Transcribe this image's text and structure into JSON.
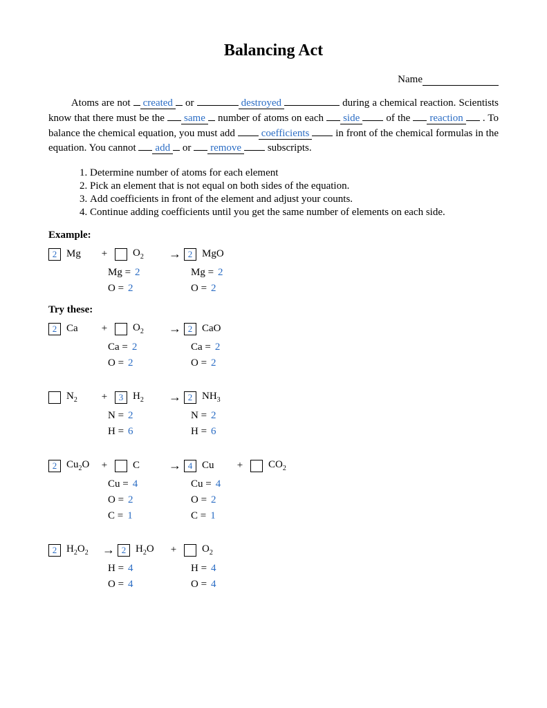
{
  "title": "Balancing Act",
  "name_label": "Name",
  "intro": {
    "t1": "Atoms are not ",
    "f1": "created",
    "t2": " or ",
    "f2": "destroyed",
    "t3": " during a chemical reaction. Scientists know that there must be the ",
    "f3": "same",
    "t4": " number of atoms on each ",
    "f4": "side",
    "t5": " of the ",
    "f5": "reaction",
    "t6": ". To balance the chemical equation, you must add ",
    "f6": "coefficients",
    "t7": " in front of the chemical formulas in the equation. You cannot ",
    "f7": "add",
    "t8": " or ",
    "f8": "remove",
    "t9": " subscripts."
  },
  "steps": [
    "Determine number of atoms for each element",
    "Pick an element that is not equal on both sides of the equation.",
    "Add coefficients in front of the element and adjust your counts.",
    "Continue adding coefficients until you get the same number of elements on each side."
  ],
  "example_label": "Example:",
  "try_label": "Try these:",
  "eq1": {
    "b1": "2",
    "r1": "Mg",
    "b2": "",
    "r2": "O",
    "s2": "2",
    "b3": "2",
    "r3": "MgO",
    "c": [
      {
        "l": "Mg =",
        "lv": "2",
        "r": "Mg =",
        "rv": "2"
      },
      {
        "l": "O =",
        "lv": "2",
        "r": "O =",
        "rv": "2"
      }
    ]
  },
  "eq2": {
    "b1": "2",
    "r1": "Ca",
    "b2": "",
    "r2": "O",
    "s2": "2",
    "b3": "2",
    "r3": "CaO",
    "c": [
      {
        "l": "Ca =",
        "lv": "2",
        "r": "Ca =",
        "rv": "2"
      },
      {
        "l": "O =",
        "lv": "2",
        "r": "O =",
        "rv": "2"
      }
    ]
  },
  "eq3": {
    "b1": "",
    "r1": "N",
    "s1": "2",
    "b2": "3",
    "r2": "H",
    "s2": "2",
    "b3": "2",
    "r3": "NH",
    "s3": "3",
    "c": [
      {
        "l": "N =",
        "lv": "2",
        "r": "N =",
        "rv": "2"
      },
      {
        "l": "H =",
        "lv": "6",
        "r": "H =",
        "rv": "6"
      }
    ]
  },
  "eq4": {
    "b1": "2",
    "r1": "Cu",
    "s1a": "2",
    "r1b": "O",
    "b2": "",
    "r2": "C",
    "b3": "4",
    "r3": "Cu",
    "b4": "",
    "r4": "CO",
    "s4": "2",
    "c": [
      {
        "l": "Cu =",
        "lv": "4",
        "r": "Cu =",
        "rv": "4"
      },
      {
        "l": "O =",
        "lv": "2",
        "r": "O =",
        "rv": "2"
      },
      {
        "l": "C =",
        "lv": "1",
        "r": "C =",
        "rv": "1"
      }
    ]
  },
  "eq5": {
    "b1": "2",
    "r1": "H",
    "s1a": "2",
    "r1b": "O",
    "s1c": "2",
    "b2": "2",
    "r2": "H",
    "s2a": "2",
    "r2b": "O",
    "b3": "",
    "r3": "O",
    "s3": "2",
    "c": [
      {
        "l": "H =",
        "lv": "4",
        "r": "H =",
        "rv": "4"
      },
      {
        "l": "O =",
        "lv": "4",
        "r": "O =",
        "rv": "4"
      }
    ]
  }
}
